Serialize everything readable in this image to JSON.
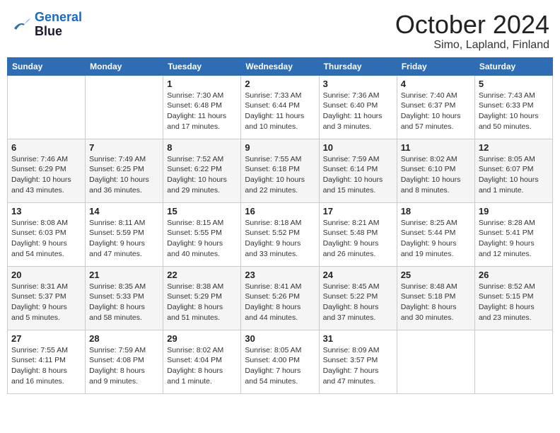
{
  "logo": {
    "line1": "General",
    "line2": "Blue"
  },
  "header": {
    "title": "October 2024",
    "subtitle": "Simo, Lapland, Finland"
  },
  "weekdays": [
    "Sunday",
    "Monday",
    "Tuesday",
    "Wednesday",
    "Thursday",
    "Friday",
    "Saturday"
  ],
  "weeks": [
    [
      {
        "day": "",
        "info": ""
      },
      {
        "day": "",
        "info": ""
      },
      {
        "day": "1",
        "info": "Sunrise: 7:30 AM\nSunset: 6:48 PM\nDaylight: 11 hours\nand 17 minutes."
      },
      {
        "day": "2",
        "info": "Sunrise: 7:33 AM\nSunset: 6:44 PM\nDaylight: 11 hours\nand 10 minutes."
      },
      {
        "day": "3",
        "info": "Sunrise: 7:36 AM\nSunset: 6:40 PM\nDaylight: 11 hours\nand 3 minutes."
      },
      {
        "day": "4",
        "info": "Sunrise: 7:40 AM\nSunset: 6:37 PM\nDaylight: 10 hours\nand 57 minutes."
      },
      {
        "day": "5",
        "info": "Sunrise: 7:43 AM\nSunset: 6:33 PM\nDaylight: 10 hours\nand 50 minutes."
      }
    ],
    [
      {
        "day": "6",
        "info": "Sunrise: 7:46 AM\nSunset: 6:29 PM\nDaylight: 10 hours\nand 43 minutes."
      },
      {
        "day": "7",
        "info": "Sunrise: 7:49 AM\nSunset: 6:25 PM\nDaylight: 10 hours\nand 36 minutes."
      },
      {
        "day": "8",
        "info": "Sunrise: 7:52 AM\nSunset: 6:22 PM\nDaylight: 10 hours\nand 29 minutes."
      },
      {
        "day": "9",
        "info": "Sunrise: 7:55 AM\nSunset: 6:18 PM\nDaylight: 10 hours\nand 22 minutes."
      },
      {
        "day": "10",
        "info": "Sunrise: 7:59 AM\nSunset: 6:14 PM\nDaylight: 10 hours\nand 15 minutes."
      },
      {
        "day": "11",
        "info": "Sunrise: 8:02 AM\nSunset: 6:10 PM\nDaylight: 10 hours\nand 8 minutes."
      },
      {
        "day": "12",
        "info": "Sunrise: 8:05 AM\nSunset: 6:07 PM\nDaylight: 10 hours\nand 1 minute."
      }
    ],
    [
      {
        "day": "13",
        "info": "Sunrise: 8:08 AM\nSunset: 6:03 PM\nDaylight: 9 hours\nand 54 minutes."
      },
      {
        "day": "14",
        "info": "Sunrise: 8:11 AM\nSunset: 5:59 PM\nDaylight: 9 hours\nand 47 minutes."
      },
      {
        "day": "15",
        "info": "Sunrise: 8:15 AM\nSunset: 5:55 PM\nDaylight: 9 hours\nand 40 minutes."
      },
      {
        "day": "16",
        "info": "Sunrise: 8:18 AM\nSunset: 5:52 PM\nDaylight: 9 hours\nand 33 minutes."
      },
      {
        "day": "17",
        "info": "Sunrise: 8:21 AM\nSunset: 5:48 PM\nDaylight: 9 hours\nand 26 minutes."
      },
      {
        "day": "18",
        "info": "Sunrise: 8:25 AM\nSunset: 5:44 PM\nDaylight: 9 hours\nand 19 minutes."
      },
      {
        "day": "19",
        "info": "Sunrise: 8:28 AM\nSunset: 5:41 PM\nDaylight: 9 hours\nand 12 minutes."
      }
    ],
    [
      {
        "day": "20",
        "info": "Sunrise: 8:31 AM\nSunset: 5:37 PM\nDaylight: 9 hours\nand 5 minutes."
      },
      {
        "day": "21",
        "info": "Sunrise: 8:35 AM\nSunset: 5:33 PM\nDaylight: 8 hours\nand 58 minutes."
      },
      {
        "day": "22",
        "info": "Sunrise: 8:38 AM\nSunset: 5:29 PM\nDaylight: 8 hours\nand 51 minutes."
      },
      {
        "day": "23",
        "info": "Sunrise: 8:41 AM\nSunset: 5:26 PM\nDaylight: 8 hours\nand 44 minutes."
      },
      {
        "day": "24",
        "info": "Sunrise: 8:45 AM\nSunset: 5:22 PM\nDaylight: 8 hours\nand 37 minutes."
      },
      {
        "day": "25",
        "info": "Sunrise: 8:48 AM\nSunset: 5:18 PM\nDaylight: 8 hours\nand 30 minutes."
      },
      {
        "day": "26",
        "info": "Sunrise: 8:52 AM\nSunset: 5:15 PM\nDaylight: 8 hours\nand 23 minutes."
      }
    ],
    [
      {
        "day": "27",
        "info": "Sunrise: 7:55 AM\nSunset: 4:11 PM\nDaylight: 8 hours\nand 16 minutes."
      },
      {
        "day": "28",
        "info": "Sunrise: 7:59 AM\nSunset: 4:08 PM\nDaylight: 8 hours\nand 9 minutes."
      },
      {
        "day": "29",
        "info": "Sunrise: 8:02 AM\nSunset: 4:04 PM\nDaylight: 8 hours\nand 1 minute."
      },
      {
        "day": "30",
        "info": "Sunrise: 8:05 AM\nSunset: 4:00 PM\nDaylight: 7 hours\nand 54 minutes."
      },
      {
        "day": "31",
        "info": "Sunrise: 8:09 AM\nSunset: 3:57 PM\nDaylight: 7 hours\nand 47 minutes."
      },
      {
        "day": "",
        "info": ""
      },
      {
        "day": "",
        "info": ""
      }
    ]
  ]
}
